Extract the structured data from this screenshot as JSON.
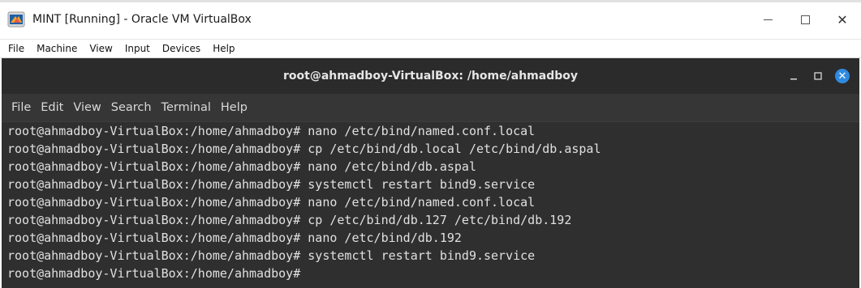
{
  "host_window": {
    "title": "MINT [Running] - Oracle VM VirtualBox",
    "controls": {
      "minimize": "",
      "maximize": "",
      "close": "✕"
    }
  },
  "vbox_menu": [
    "File",
    "Machine",
    "View",
    "Input",
    "Devices",
    "Help"
  ],
  "terminal": {
    "title": "root@ahmadboy-VirtualBox: /home/ahmadboy",
    "menu": [
      "File",
      "Edit",
      "View",
      "Search",
      "Terminal",
      "Help"
    ],
    "lines": [
      "root@ahmadboy-VirtualBox:/home/ahmadboy# nano /etc/bind/named.conf.local",
      "root@ahmadboy-VirtualBox:/home/ahmadboy# cp /etc/bind/db.local /etc/bind/db.aspal",
      "root@ahmadboy-VirtualBox:/home/ahmadboy# nano /etc/bind/db.aspal",
      "root@ahmadboy-VirtualBox:/home/ahmadboy# systemctl restart bind9.service",
      "root@ahmadboy-VirtualBox:/home/ahmadboy# nano /etc/bind/named.conf.local",
      "root@ahmadboy-VirtualBox:/home/ahmadboy# cp /etc/bind/db.127 /etc/bind/db.192",
      "root@ahmadboy-VirtualBox:/home/ahmadboy# nano /etc/bind/db.192",
      "root@ahmadboy-VirtualBox:/home/ahmadboy# systemctl restart bind9.service",
      "root@ahmadboy-VirtualBox:/home/ahmadboy#"
    ]
  },
  "colors": {
    "terminal_bg": "#2f2f2f",
    "terminal_text": "#e0e0e0",
    "close_accent": "#2f8ae0"
  },
  "icons": {
    "app_icon": "virtualbox-logo-icon",
    "terminal_close": "close-icon"
  }
}
